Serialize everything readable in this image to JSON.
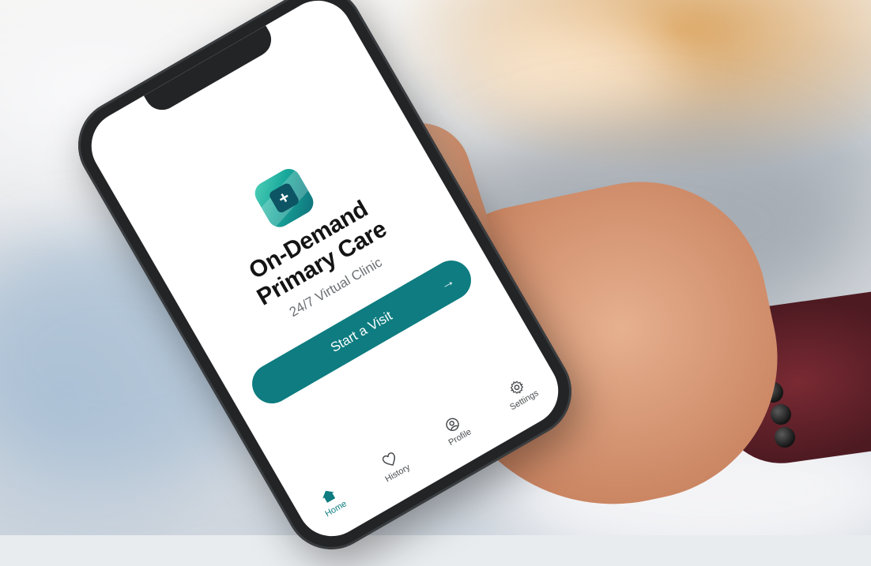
{
  "app": {
    "title_line1": "On-Demand",
    "title_line2": "Primary Care",
    "subtitle": "24/7 Virtual Clinic",
    "icon": "medical-plus-app-icon",
    "accent": "#0e7c80"
  },
  "cta": {
    "label": "Start a Visit",
    "icon": "arrow-right-icon"
  },
  "tabs": [
    {
      "label": "Home",
      "icon": "home-icon",
      "active": true
    },
    {
      "label": "History",
      "icon": "heart-icon",
      "active": false
    },
    {
      "label": "Profile",
      "icon": "profile-icon",
      "active": false
    },
    {
      "label": "Settings",
      "icon": "gear-icon",
      "active": false
    }
  ]
}
